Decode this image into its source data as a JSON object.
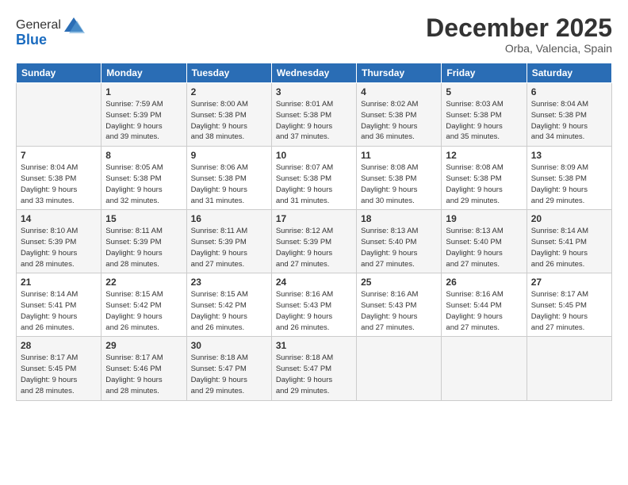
{
  "logo": {
    "general": "General",
    "blue": "Blue"
  },
  "header": {
    "month": "December 2025",
    "location": "Orba, Valencia, Spain"
  },
  "weekdays": [
    "Sunday",
    "Monday",
    "Tuesday",
    "Wednesday",
    "Thursday",
    "Friday",
    "Saturday"
  ],
  "weeks": [
    [
      {
        "num": "",
        "detail": ""
      },
      {
        "num": "1",
        "detail": "Sunrise: 7:59 AM\nSunset: 5:39 PM\nDaylight: 9 hours\nand 39 minutes."
      },
      {
        "num": "2",
        "detail": "Sunrise: 8:00 AM\nSunset: 5:38 PM\nDaylight: 9 hours\nand 38 minutes."
      },
      {
        "num": "3",
        "detail": "Sunrise: 8:01 AM\nSunset: 5:38 PM\nDaylight: 9 hours\nand 37 minutes."
      },
      {
        "num": "4",
        "detail": "Sunrise: 8:02 AM\nSunset: 5:38 PM\nDaylight: 9 hours\nand 36 minutes."
      },
      {
        "num": "5",
        "detail": "Sunrise: 8:03 AM\nSunset: 5:38 PM\nDaylight: 9 hours\nand 35 minutes."
      },
      {
        "num": "6",
        "detail": "Sunrise: 8:04 AM\nSunset: 5:38 PM\nDaylight: 9 hours\nand 34 minutes."
      }
    ],
    [
      {
        "num": "7",
        "detail": "Sunrise: 8:04 AM\nSunset: 5:38 PM\nDaylight: 9 hours\nand 33 minutes."
      },
      {
        "num": "8",
        "detail": "Sunrise: 8:05 AM\nSunset: 5:38 PM\nDaylight: 9 hours\nand 32 minutes."
      },
      {
        "num": "9",
        "detail": "Sunrise: 8:06 AM\nSunset: 5:38 PM\nDaylight: 9 hours\nand 31 minutes."
      },
      {
        "num": "10",
        "detail": "Sunrise: 8:07 AM\nSunset: 5:38 PM\nDaylight: 9 hours\nand 31 minutes."
      },
      {
        "num": "11",
        "detail": "Sunrise: 8:08 AM\nSunset: 5:38 PM\nDaylight: 9 hours\nand 30 minutes."
      },
      {
        "num": "12",
        "detail": "Sunrise: 8:08 AM\nSunset: 5:38 PM\nDaylight: 9 hours\nand 29 minutes."
      },
      {
        "num": "13",
        "detail": "Sunrise: 8:09 AM\nSunset: 5:38 PM\nDaylight: 9 hours\nand 29 minutes."
      }
    ],
    [
      {
        "num": "14",
        "detail": "Sunrise: 8:10 AM\nSunset: 5:39 PM\nDaylight: 9 hours\nand 28 minutes."
      },
      {
        "num": "15",
        "detail": "Sunrise: 8:11 AM\nSunset: 5:39 PM\nDaylight: 9 hours\nand 28 minutes."
      },
      {
        "num": "16",
        "detail": "Sunrise: 8:11 AM\nSunset: 5:39 PM\nDaylight: 9 hours\nand 27 minutes."
      },
      {
        "num": "17",
        "detail": "Sunrise: 8:12 AM\nSunset: 5:39 PM\nDaylight: 9 hours\nand 27 minutes."
      },
      {
        "num": "18",
        "detail": "Sunrise: 8:13 AM\nSunset: 5:40 PM\nDaylight: 9 hours\nand 27 minutes."
      },
      {
        "num": "19",
        "detail": "Sunrise: 8:13 AM\nSunset: 5:40 PM\nDaylight: 9 hours\nand 27 minutes."
      },
      {
        "num": "20",
        "detail": "Sunrise: 8:14 AM\nSunset: 5:41 PM\nDaylight: 9 hours\nand 26 minutes."
      }
    ],
    [
      {
        "num": "21",
        "detail": "Sunrise: 8:14 AM\nSunset: 5:41 PM\nDaylight: 9 hours\nand 26 minutes."
      },
      {
        "num": "22",
        "detail": "Sunrise: 8:15 AM\nSunset: 5:42 PM\nDaylight: 9 hours\nand 26 minutes."
      },
      {
        "num": "23",
        "detail": "Sunrise: 8:15 AM\nSunset: 5:42 PM\nDaylight: 9 hours\nand 26 minutes."
      },
      {
        "num": "24",
        "detail": "Sunrise: 8:16 AM\nSunset: 5:43 PM\nDaylight: 9 hours\nand 26 minutes."
      },
      {
        "num": "25",
        "detail": "Sunrise: 8:16 AM\nSunset: 5:43 PM\nDaylight: 9 hours\nand 27 minutes."
      },
      {
        "num": "26",
        "detail": "Sunrise: 8:16 AM\nSunset: 5:44 PM\nDaylight: 9 hours\nand 27 minutes."
      },
      {
        "num": "27",
        "detail": "Sunrise: 8:17 AM\nSunset: 5:45 PM\nDaylight: 9 hours\nand 27 minutes."
      }
    ],
    [
      {
        "num": "28",
        "detail": "Sunrise: 8:17 AM\nSunset: 5:45 PM\nDaylight: 9 hours\nand 28 minutes."
      },
      {
        "num": "29",
        "detail": "Sunrise: 8:17 AM\nSunset: 5:46 PM\nDaylight: 9 hours\nand 28 minutes."
      },
      {
        "num": "30",
        "detail": "Sunrise: 8:18 AM\nSunset: 5:47 PM\nDaylight: 9 hours\nand 29 minutes."
      },
      {
        "num": "31",
        "detail": "Sunrise: 8:18 AM\nSunset: 5:47 PM\nDaylight: 9 hours\nand 29 minutes."
      },
      {
        "num": "",
        "detail": ""
      },
      {
        "num": "",
        "detail": ""
      },
      {
        "num": "",
        "detail": ""
      }
    ]
  ]
}
